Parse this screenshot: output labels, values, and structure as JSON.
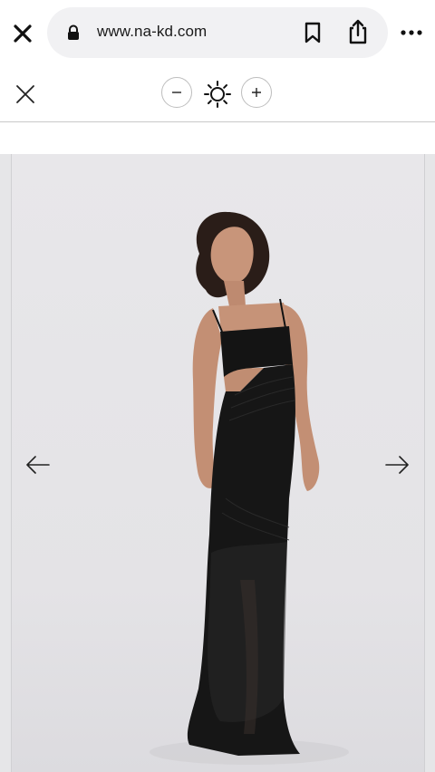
{
  "browser": {
    "url": "www.na-kd.com",
    "icons": [
      "close-icon",
      "lock-icon",
      "bookmark-icon",
      "share-icon",
      "more-icon"
    ]
  },
  "viewer": {
    "icons": [
      "close-icon",
      "zoom-out-icon",
      "brightness-icon",
      "zoom-in-icon"
    ]
  },
  "gallery": {
    "icons": [
      "arrow-left-icon",
      "arrow-right-icon"
    ],
    "product_image": "woman-in-black-maxi-dress",
    "colors": {
      "background": "#e8e7ea",
      "dress": "#141414"
    }
  }
}
